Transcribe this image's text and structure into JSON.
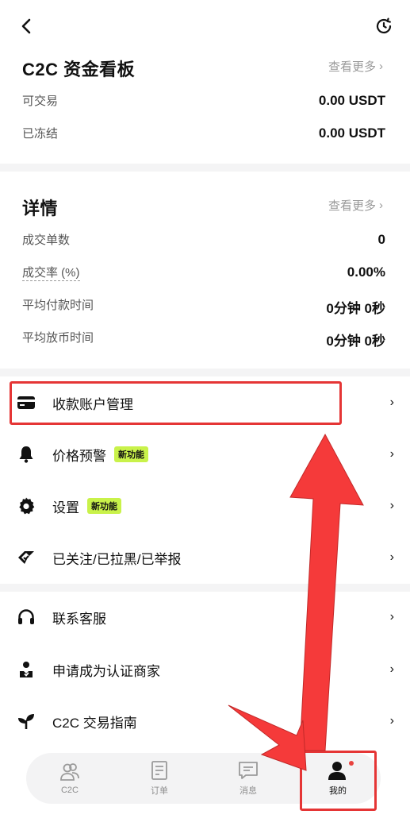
{
  "topbar": {
    "back_icon": "chevron-left-icon",
    "history_icon": "history-icon"
  },
  "funds": {
    "title": "C2C 资金看板",
    "more": "查看更多",
    "rows": [
      {
        "label": "可交易",
        "value": "0.00 USDT"
      },
      {
        "label": "已冻结",
        "value": "0.00 USDT"
      }
    ]
  },
  "details": {
    "title": "详情",
    "more": "查看更多",
    "rows": [
      {
        "label": "成交单数",
        "value": "0"
      },
      {
        "label": "成交率 (%)",
        "value": "0.00%"
      },
      {
        "label": "平均付款时间",
        "value": "0分钟 0秒"
      },
      {
        "label": "平均放币时间",
        "value": "0分钟 0秒"
      }
    ]
  },
  "menu": [
    {
      "label": "收款账户管理",
      "icon": "card-icon"
    },
    {
      "label": "价格预警",
      "icon": "bell-icon",
      "badge": "新功能"
    },
    {
      "label": "设置",
      "icon": "gear-icon",
      "badge": "新功能"
    },
    {
      "label": "已关注/已拉黑/已举报",
      "icon": "tag-icon"
    },
    {
      "label": "联系客服",
      "icon": "headset-icon"
    },
    {
      "label": "申请成为认证商家",
      "icon": "merchant-icon"
    },
    {
      "label": "C2C 交易指南",
      "icon": "sprout-icon"
    }
  ],
  "tabs": [
    {
      "label": "C2C",
      "icon": "users-icon"
    },
    {
      "label": "订单",
      "icon": "order-icon"
    },
    {
      "label": "消息",
      "icon": "message-icon"
    },
    {
      "label": "我的",
      "icon": "person-icon",
      "active": true
    }
  ],
  "colors": {
    "accent_red": "#e53535",
    "badge_green": "#c9f24a",
    "gap_gray": "#f4f4f5"
  }
}
